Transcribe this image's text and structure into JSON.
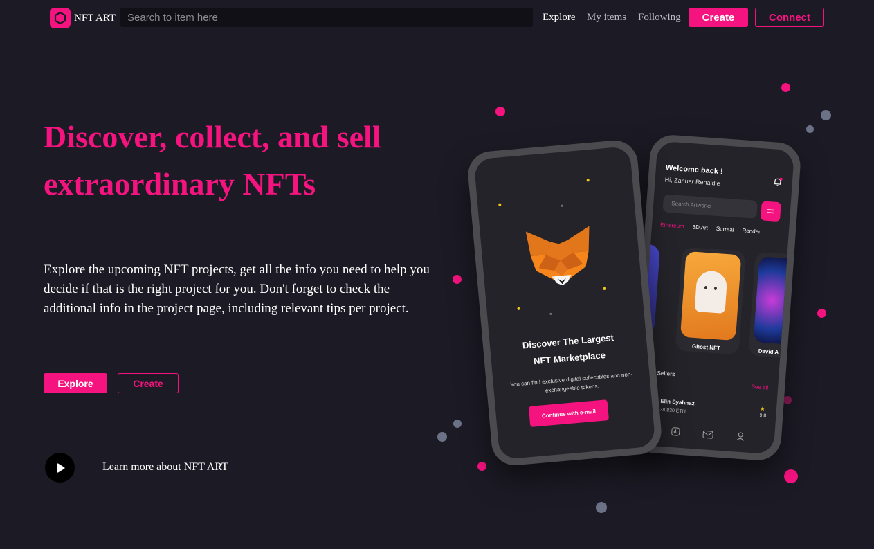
{
  "nav": {
    "brand": "NFT ART",
    "search_placeholder": "Search to item here",
    "links": [
      "Explore",
      "My items",
      "Following"
    ],
    "create_label": "Create",
    "connect_label": "Connect"
  },
  "hero": {
    "title_line1": "Discover, collect, and sell",
    "title_line2": "extraordinary NFTs",
    "description": "Explore the upcoming NFT projects, get all the info you need to help you decide if that is the right project for you. Don't forget to check the additional info in the project page, including relevant tips per project.",
    "explore_label": "Explore",
    "create_label": "Create",
    "learn_more": "Learn more about NFT ART"
  },
  "phone_back": {
    "welcome": "Welcome back !",
    "greeting": "Hi, Zanuar Renaldie",
    "search_placeholder": "Search Artworks",
    "tabs": [
      "Ethereum",
      "3D Art",
      "Surreal",
      "Render"
    ],
    "card_center_label": "Ghost NFT",
    "card_right_label": "David A",
    "sellers_label": "Top Sellers",
    "see_all": "See all",
    "seller_name": "Elin Syahnaz",
    "seller_eth": "38.830 ETH",
    "seller_rating": "9.8"
  },
  "phone_front": {
    "title_line1": "Discover The Largest",
    "title_line2": "NFT Marketplace",
    "subtitle": "You can find exclusive digital collectibles and non-exchangeable tokens.",
    "button": "Continue with e-mail"
  },
  "colors": {
    "accent": "#f5137f",
    "background": "#1c1b25",
    "search_bg": "#101016"
  }
}
